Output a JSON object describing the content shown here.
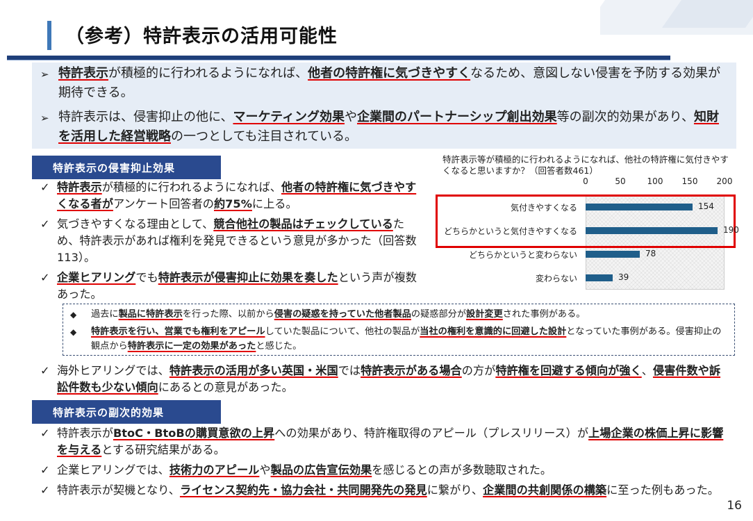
{
  "title": "（参考）特許表示の活用可能性",
  "summary": [
    {
      "arrow": "➢",
      "parts": [
        {
          "t": "特許表示",
          "hl": true
        },
        {
          "t": "が積極的に行われるようになれば、"
        },
        {
          "t": "他者の特許権に気づきやすく",
          "hl": true
        },
        {
          "t": "なるため、意図しない侵害を予防する効果が期待できる。"
        }
      ]
    },
    {
      "arrow": "➢",
      "parts": [
        {
          "t": "特許表示は、侵害抑止の他に、"
        },
        {
          "t": "マーケティング効果",
          "hl": true
        },
        {
          "t": "や"
        },
        {
          "t": "企業間のパートナーシップ創出効果",
          "hl": true
        },
        {
          "t": "等の副次的効果があり、"
        },
        {
          "t": "知財を活用した経営戦略",
          "hl": true
        },
        {
          "t": "の一つとしても注目されている。"
        }
      ]
    }
  ],
  "section1": {
    "label": "特許表示の侵害抑止効果"
  },
  "bullets1": [
    {
      "check": "✓",
      "parts": [
        {
          "t": "特許表示",
          "hl": true
        },
        {
          "t": "が積極的に行われるようになれば、"
        },
        {
          "t": "他者の特許権に気づきやすくなる者が",
          "hl": true
        },
        {
          "t": "アンケート回答者の"
        },
        {
          "t": "約75%",
          "hl": true
        },
        {
          "t": "に上る。"
        }
      ]
    },
    {
      "check": "✓",
      "parts": [
        {
          "t": "気づきやすくなる理由として、"
        },
        {
          "t": "競合他社の製品はチェックしている",
          "hl": true
        },
        {
          "t": "ため、特許表示があれば権利を発見できるという意見が多かった（回答数113）。"
        }
      ]
    },
    {
      "check": "✓",
      "parts": [
        {
          "t": "企業ヒアリング",
          "hl": true
        },
        {
          "t": "でも"
        },
        {
          "t": "特許表示が侵害抑止に効果を奏した",
          "hl": true
        },
        {
          "t": "という声が複数あった。"
        }
      ]
    }
  ],
  "quotes": [
    {
      "marker": "◆",
      "parts": [
        {
          "t": "過去に"
        },
        {
          "t": "製品に特許表示",
          "hl": true
        },
        {
          "t": "を行った際、以前から"
        },
        {
          "t": "侵害の疑惑を持っていた他者製品",
          "hl": true
        },
        {
          "t": "の疑惑部分が"
        },
        {
          "t": "設計変更",
          "hl": true
        },
        {
          "t": "された事例がある。"
        }
      ]
    },
    {
      "marker": "◆",
      "parts": [
        {
          "t": "特許表示を行い、営業でも権利をアピール",
          "hl": true
        },
        {
          "t": "していた製品について、他社の製品が"
        },
        {
          "t": "当社の権利を意識的に回避した設計",
          "hl": true
        },
        {
          "t": "となっていた事例がある。侵害抑止の観点から"
        },
        {
          "t": "特許表示に一定の効果があった",
          "hl": true
        },
        {
          "t": "と感じた。"
        }
      ]
    }
  ],
  "bullets2": [
    {
      "check": "✓",
      "parts": [
        {
          "t": "海外ヒアリングでは、"
        },
        {
          "t": "特許表示の活用が多い英国・米国",
          "hl": true
        },
        {
          "t": "では"
        },
        {
          "t": "特許表示がある場合",
          "hl": true
        },
        {
          "t": "の方が"
        },
        {
          "t": "特許権を回避する傾向が強く",
          "hl": true
        },
        {
          "t": "、"
        },
        {
          "t": "侵害件数や訴訟件数も少ない傾向",
          "hl": true
        },
        {
          "t": "にあるとの意見があった。"
        }
      ]
    }
  ],
  "section2": {
    "label": "特許表示の副次的効果"
  },
  "bullets3": [
    {
      "check": "✓",
      "parts": [
        {
          "t": "特許表示が"
        },
        {
          "t": "BtoC・BtoBの購買意欲の上昇",
          "hl": true
        },
        {
          "t": "への効果があり、特許権取得のアピール（プレスリリース）が"
        },
        {
          "t": "上場企業の株価上昇に影響を与える",
          "hl": true
        },
        {
          "t": "とする研究結果がある。"
        }
      ]
    },
    {
      "check": "✓",
      "parts": [
        {
          "t": "企業ヒアリングでは、"
        },
        {
          "t": "技術力のアピール",
          "hl": true
        },
        {
          "t": "や"
        },
        {
          "t": "製品の広告宣伝効果",
          "hl": true
        },
        {
          "t": "を感じるとの声が多数聴取された。"
        }
      ]
    },
    {
      "check": "✓",
      "parts": [
        {
          "t": "特許表示が契機となり、"
        },
        {
          "t": "ライセンス契約先・協力会社・共同開発先の発見",
          "hl": true
        },
        {
          "t": "に繋がり、"
        },
        {
          "t": "企業間の共創関係の構築",
          "hl": true
        },
        {
          "t": "に至った例もあった。"
        }
      ]
    }
  ],
  "chart_data": {
    "type": "bar",
    "orientation": "horizontal",
    "title": "特許表示等が積極的に行われるようになれば、他社の特許権に気付きやすくなると思いますか？（回答者数461）",
    "categories": [
      "気付きやすくなる",
      "どちらかというと気付きやすくなる",
      "どちらかというと変わらない",
      "変わらない"
    ],
    "values": [
      154,
      190,
      78,
      39
    ],
    "xlim": [
      0,
      200
    ],
    "xticks": [
      "0",
      "50",
      "100",
      "150",
      "200"
    ],
    "bar_color": "#1f5e8a",
    "highlight_color": "#e00000",
    "highlighted_categories": [
      "気付きやすくなる",
      "どちらかというと気付きやすくなる"
    ]
  },
  "page_number": "16"
}
